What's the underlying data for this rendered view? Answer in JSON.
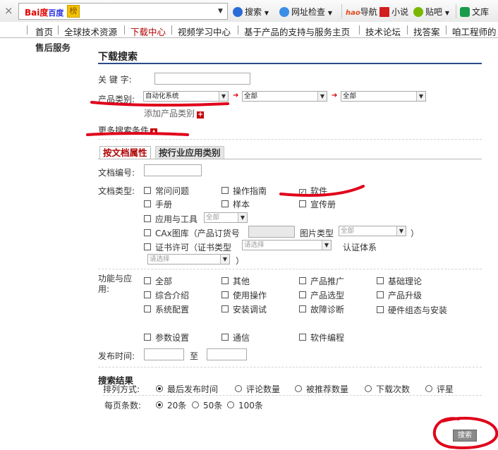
{
  "browser_toolbar": {
    "close_glyph": "×",
    "search_engine": "Bai度百度",
    "search_engine_parts": [
      "Bai",
      "度",
      "百度"
    ],
    "search_logo_char": "榜",
    "items": [
      {
        "label": "搜索",
        "icon": "search-icon",
        "color": "#2a6bd6"
      },
      {
        "label": "网址检查",
        "icon": "shield-icon",
        "color": "#3a8ee6"
      },
      {
        "label": "导航",
        "icon": "hao-logo-icon",
        "color": "#e24a1e",
        "logo_text": "hao"
      },
      {
        "label": "小说",
        "icon": "grid-icon",
        "color": "#d11e1e"
      },
      {
        "label": "贴吧",
        "icon": "chat-icon",
        "color": "#7ab800"
      },
      {
        "label": "文库",
        "icon": "document-icon",
        "color": "#1a9b4b"
      }
    ]
  },
  "nav": {
    "items": [
      "首页",
      "全球技术资源",
      "下载中心",
      "视频学习中心",
      "基于产品的支持与服务主页",
      "技术论坛",
      "找答案",
      "咱工程师的"
    ],
    "active_index": 2
  },
  "sidebar": {
    "label": "售后服务"
  },
  "form": {
    "title": "下载搜索",
    "keyword_label": "关 键 字:",
    "keyword_value": "",
    "product_category_label": "产品类别:",
    "category_selects": [
      "自动化系统",
      "全部",
      "全部"
    ],
    "add_category_label": "添加产品类别",
    "more_conditions_label": "更多搜索条件",
    "tabs": [
      "按文档属性",
      "按行业应用类别"
    ],
    "doc_number_label": "文档编号:",
    "doc_type_label": "文档类型:",
    "doc_types": [
      {
        "label": "常问问题",
        "checked": false
      },
      {
        "label": "操作指南",
        "checked": false
      },
      {
        "label": "软件",
        "checked": true
      },
      {
        "label": "手册",
        "checked": false
      },
      {
        "label": "样本",
        "checked": false
      },
      {
        "label": "宣传册",
        "checked": false
      }
    ],
    "app_tools_label": "应用与工具",
    "app_tools_select": "全部",
    "cax_label": "CAx图库（产品订货号",
    "picture_type_label": "图片类型",
    "picture_type_select": "全部",
    "close_paren": "）",
    "cert_label": "证书许可（证书类型",
    "cert_type_select": "请选择",
    "cert_system_label": "认证体系",
    "cert_system_select": "请选择",
    "function_label": "功能与应用:",
    "functions": [
      "全部",
      "其他",
      "产品推广",
      "基础理论",
      "综合介绍",
      "使用操作",
      "产品选型",
      "产品升级",
      "系统配置",
      "安装调试",
      "故障诊断",
      "硬件组态与安装",
      "参数设置",
      "通信",
      "软件编程"
    ],
    "publish_time_label": "发布时间:",
    "to_label": "至",
    "results_title": "搜索结果",
    "sort_label": "排列方式:",
    "sort_options": [
      "最后发布时间",
      "评论数量",
      "被推荐数量",
      "下载次数",
      "评星"
    ],
    "sort_selected_index": 0,
    "per_page_label": "每页条数:",
    "per_page_options": [
      "20条",
      "50条",
      "100条"
    ],
    "per_page_selected_index": 0,
    "search_button": "搜索"
  },
  "colors": {
    "accent_red": "#b00000",
    "annotation_red": "#e0001a",
    "title_rule": "#2a4a8a"
  }
}
